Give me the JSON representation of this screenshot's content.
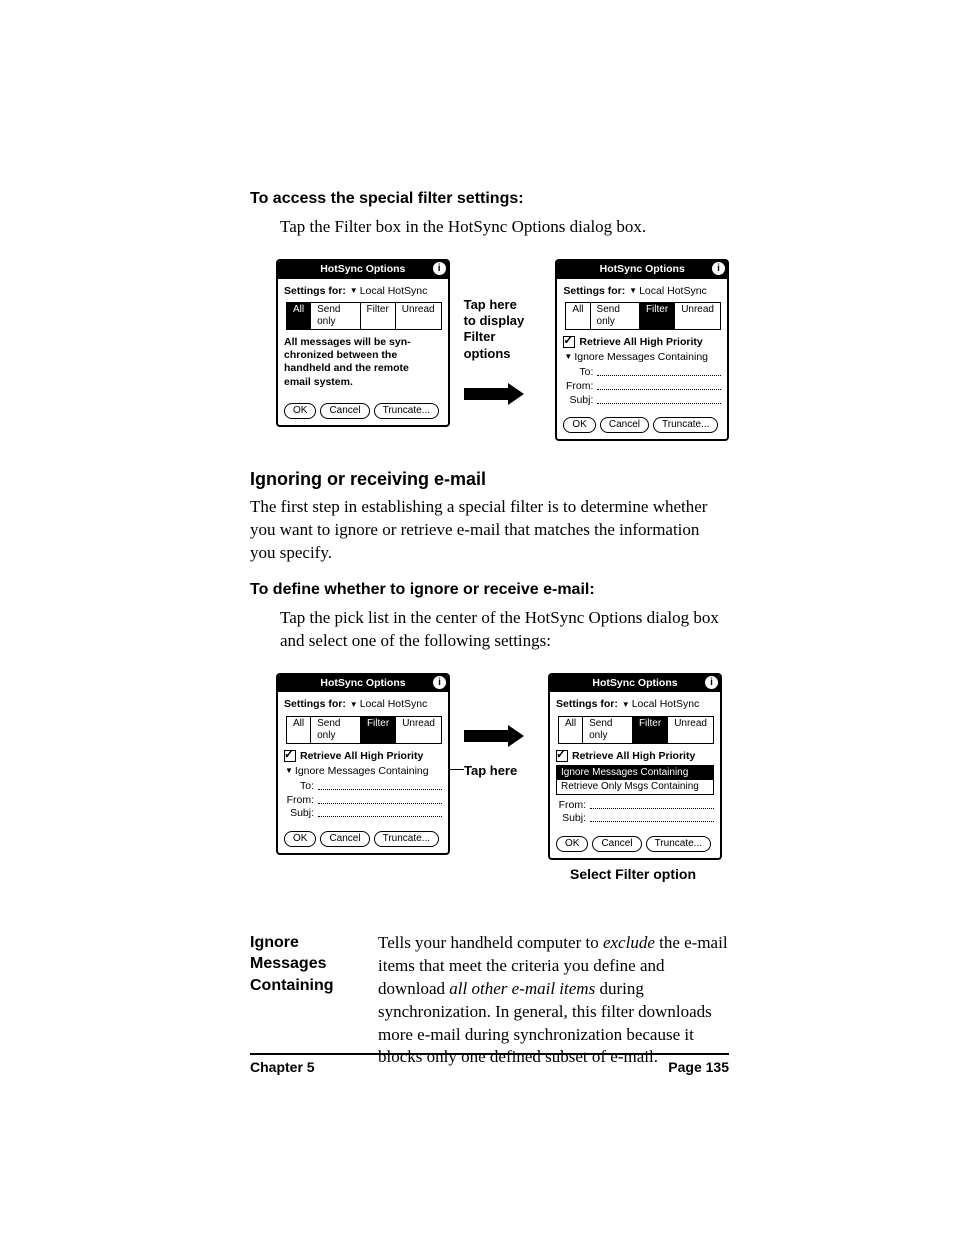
{
  "proc1": {
    "heading": "To access the special filter settings:",
    "step": "Tap the Filter box in the HotSync Options dialog box."
  },
  "fig1": {
    "mid_line1": "Tap here",
    "mid_line2": "to display",
    "mid_line3": "Filter",
    "mid_line4": "options"
  },
  "palm": {
    "title": "HotSync Options",
    "info": "i",
    "settings_label": "Settings for:",
    "settings_value": "Local HotSync",
    "tabs": {
      "all": "All",
      "send": "Send only",
      "filter": "Filter",
      "unread": "Unread"
    },
    "all_msg": "All messages will be syn-chronized between the handheld and the remote email system.",
    "retrieve": "Retrieve All High Priority",
    "ignore_pick": "Ignore Messages Containing",
    "popup_opt1": "Ignore Messages Containing",
    "popup_opt2": "Retrieve Only Msgs Containing",
    "to": "To:",
    "from": "From:",
    "subj": "Subj:",
    "ok": "OK",
    "cancel": "Cancel",
    "truncate": "Truncate..."
  },
  "section": {
    "heading": "Ignoring or receiving e-mail",
    "para": "The first step in establishing a special filter is to determine whether you want to ignore or retrieve e-mail that matches the information you specify."
  },
  "proc2": {
    "heading": "To define whether to ignore or receive e-mail:",
    "step": "Tap the pick list in the center of the HotSync Options dialog box and select one of the following settings:"
  },
  "fig2": {
    "mid": "Tap here",
    "caption": "Select Filter option"
  },
  "def": {
    "term": "Ignore Messages Containing",
    "body_1": "Tells your handheld computer to ",
    "body_i1": "exclude",
    "body_2": " the e-mail items that meet the criteria you define and download ",
    "body_i2": "all other e-mail items",
    "body_3": " during synchronization. In general, this filter downloads more e-mail during synchronization because it blocks only one defined subset of e-mail."
  },
  "footer": {
    "left": "Chapter 5",
    "right": "Page 135"
  }
}
